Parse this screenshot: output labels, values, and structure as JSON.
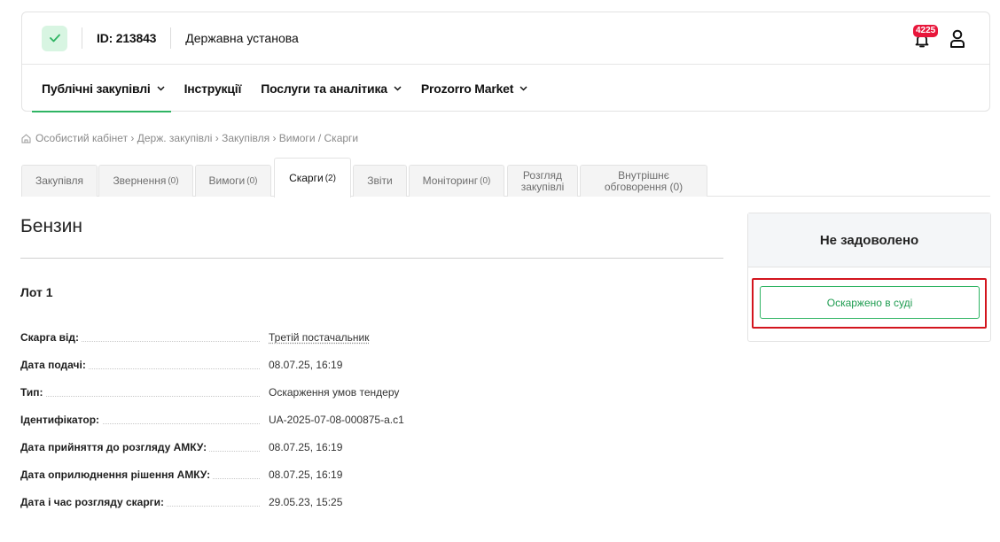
{
  "header": {
    "org_id": "ID: 213843",
    "org_type": "Державна установа",
    "notifications_count": "4225",
    "icons": {
      "status": "check-icon",
      "notifications": "bell-icon",
      "profile": "user-icon"
    },
    "accent_color": "#2fb463",
    "badge_color": "#e8163b"
  },
  "nav": {
    "items": [
      {
        "label": "Публічні закупівлі",
        "dropdown": true,
        "active": true
      },
      {
        "label": "Інструкції",
        "dropdown": false
      },
      {
        "label": "Послуги та аналітика",
        "dropdown": true
      },
      {
        "label": "Prozorro Market",
        "dropdown": true
      }
    ]
  },
  "breadcrumb": {
    "text": "Особистий кабінет › Держ. закупівлі › Закупівля › Вимоги / Скарги"
  },
  "tabs": [
    {
      "label": "Закупівля",
      "count": ""
    },
    {
      "label": "Звернення",
      "count": "(0)"
    },
    {
      "label": "Вимоги",
      "count": "(0)"
    },
    {
      "label": "Скарги",
      "count": "(2)",
      "active": true
    },
    {
      "label": "Звіти",
      "count": ""
    },
    {
      "label": "Моніторинг",
      "count": "(0)"
    },
    {
      "label": "Розгляд закупівлі",
      "count": ""
    },
    {
      "label": "Внутрішнє обговорення (0)",
      "count": ""
    }
  ],
  "main": {
    "title": "Бензин",
    "lot": "Лот 1",
    "details": [
      {
        "label": "Скарга від:",
        "value": "Третій постачальник",
        "link": true
      },
      {
        "label": "Дата подачі:",
        "value": "08.07.25, 16:19"
      },
      {
        "label": "Тип:",
        "value": "Оскарження умов тендеру"
      },
      {
        "label": "Ідентифікатор:",
        "value": "UA-2025-07-08-000875-a.c1"
      },
      {
        "label": "Дата прийняття до розгляду АМКУ:",
        "value": "08.07.25, 16:19"
      },
      {
        "label": "Дата оприлюднення рішення АМКУ:",
        "value": "08.07.25, 16:19"
      },
      {
        "label": "Дата і час розгляду скарги:",
        "value": "29.05.23, 15:25"
      }
    ]
  },
  "status": {
    "title": "Не задоволено",
    "button_label": "Оскаржено в суді",
    "highlight_color": "#d3151e"
  }
}
